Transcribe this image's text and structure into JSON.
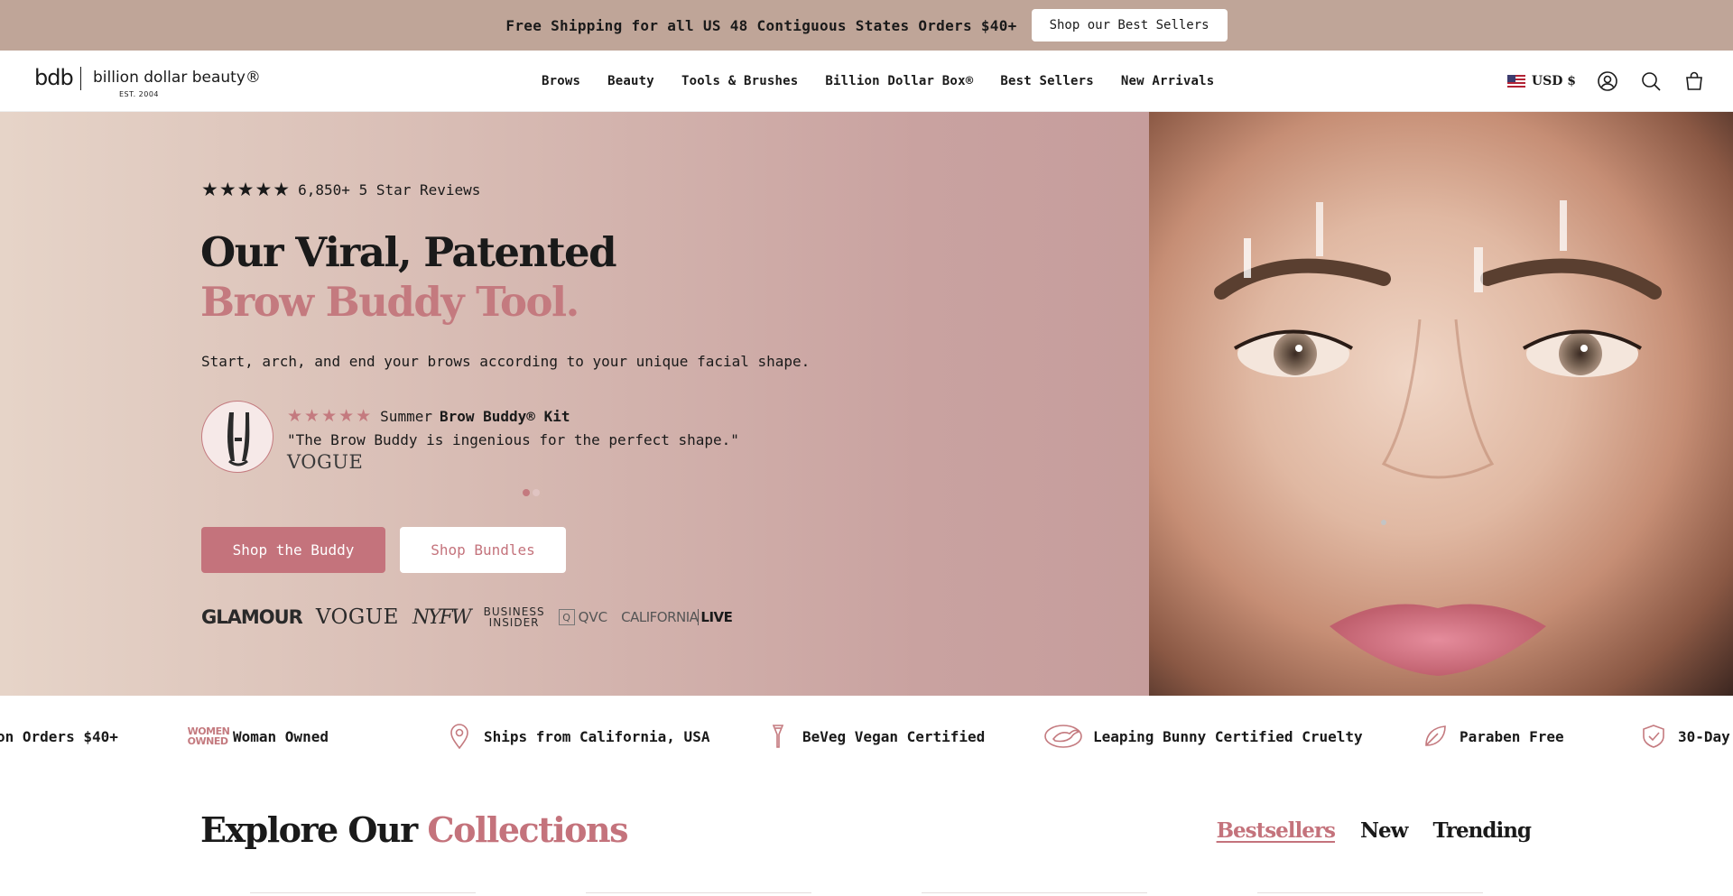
{
  "announcement": {
    "text": "Free Shipping for all US 48 Contiguous States Orders $40+",
    "button_label": "Shop our Best Sellers"
  },
  "header": {
    "logo": {
      "mark": "bdb",
      "name": "billion dollar beauty®",
      "est": "EST. 2004"
    },
    "nav": [
      {
        "label": "Brows"
      },
      {
        "label": "Beauty"
      },
      {
        "label": "Tools & Brushes"
      },
      {
        "label": "Billion Dollar Box®"
      },
      {
        "label": "Best Sellers"
      },
      {
        "label": "New Arrivals"
      }
    ],
    "currency": "USD $"
  },
  "hero": {
    "stars": "★★★★★",
    "rating_text": "6,850+ 5 Star Reviews",
    "headline_line1": "Our Viral, Patented",
    "headline_line2": "Brow Buddy Tool.",
    "subhead": "Start, arch, and end your brows according to your unique facial shape.",
    "testimonial": {
      "stars": "★★★★★",
      "product_prefix": "Summer",
      "product_name": "Brow Buddy® Kit",
      "quote": "\"The Brow Buddy is ingenious for the perfect shape.\"",
      "source": "VOGUE"
    },
    "slides_total": 2,
    "slides_active_index": 0,
    "primary_cta": "Shop the Buddy",
    "secondary_cta": "Shop Bundles",
    "press": {
      "glamour": "GLAMOUR",
      "vogue": "VOGUE",
      "nyfw": "NYFW",
      "bi_line1": "BUSINESS",
      "bi_line2": "INSIDER",
      "qvc_mark": "Q",
      "qvc": "QVC",
      "cali": "CALIFORNIA",
      "cali_live": "LIVE"
    }
  },
  "trust_strip": {
    "items": [
      {
        "label": "on Orders $40+",
        "icon": "truck-icon"
      },
      {
        "label": "Woman Owned",
        "icon": "women-owned-icon",
        "badge_line1": "WOMEN",
        "badge_line2": "OWNED"
      },
      {
        "label": "Ships from California, USA",
        "icon": "location-pin-icon"
      },
      {
        "label": "BeVeg Vegan Certified",
        "icon": "beveg-icon"
      },
      {
        "label": "Leaping Bunny Certified Cruelty",
        "icon": "bunny-icon"
      },
      {
        "label": "Paraben Free",
        "icon": "leaf-icon"
      },
      {
        "label": "30-Day",
        "icon": "shield-check-icon"
      }
    ]
  },
  "collections": {
    "title_prefix": "Explore Our",
    "title_accent": "Collections",
    "tabs": [
      {
        "label": "Bestsellers",
        "active": true
      },
      {
        "label": "New",
        "active": false
      },
      {
        "label": "Trending",
        "active": false
      }
    ]
  },
  "colors": {
    "announcement_bg": "#bfa598",
    "accent_rose": "#c4737c",
    "text": "#1a1a1a"
  }
}
